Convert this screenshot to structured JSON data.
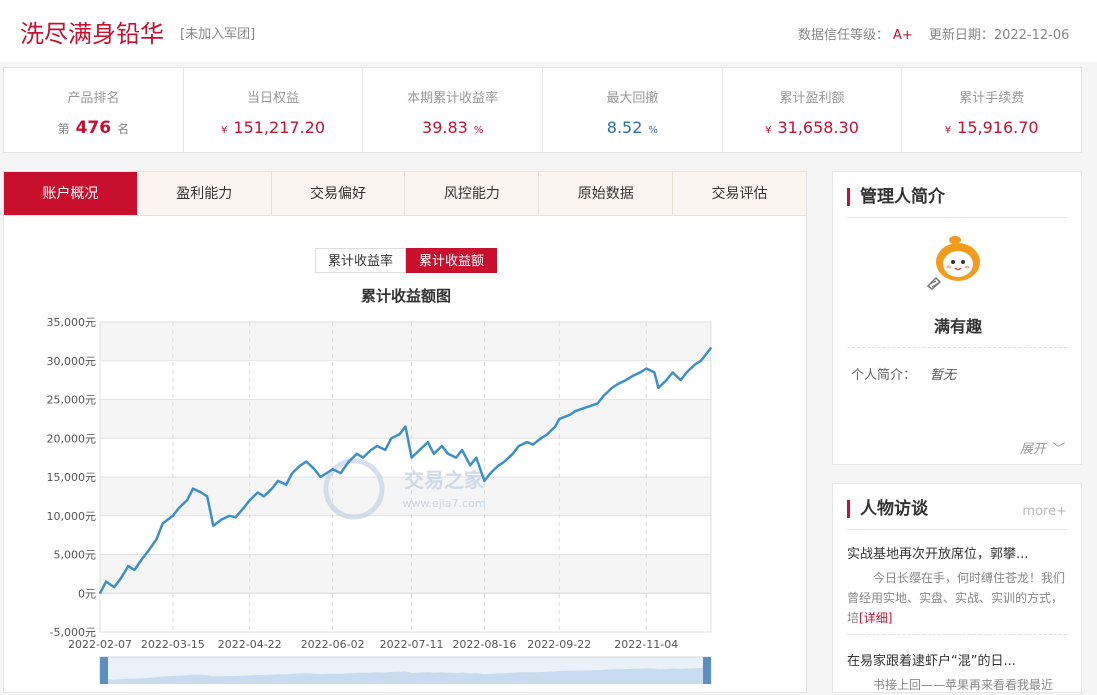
{
  "header": {
    "title": "洗尽满身铅华",
    "tag": "[未加入军团]",
    "trust_label": "数据信任等级：",
    "trust_grade": "A+",
    "update_label": "更新日期：",
    "update_date": "2022-12-06"
  },
  "stats": {
    "rank": {
      "label": "产品排名",
      "prefix": "第",
      "value": "476",
      "suffix": "名"
    },
    "equity": {
      "label": "当日权益",
      "currency": "¥",
      "value": "151,217.20"
    },
    "return_rate": {
      "label": "本期累计收益率",
      "value": "39.83",
      "unit": "%"
    },
    "max_drawdown": {
      "label": "最大回撤",
      "value": "8.52",
      "unit": "%"
    },
    "total_profit": {
      "label": "累计盈利额",
      "currency": "¥",
      "value": "31,658.30"
    },
    "total_fee": {
      "label": "累计手续费",
      "currency": "¥",
      "value": "15,916.70"
    }
  },
  "tabs": [
    "账户概况",
    "盈利能力",
    "交易偏好",
    "风控能力",
    "原始数据",
    "交易评估"
  ],
  "chart_toggle": [
    "累计收益率",
    "累计收益额"
  ],
  "colors": {
    "accent": "#c8102e",
    "line": "#3d8fc7",
    "blue_value": "#2a6fb0"
  },
  "watermark": {
    "text": "交易之家",
    "url": "www.ejia7.com"
  },
  "chart_data": {
    "type": "line",
    "title": "累计收益额图",
    "ylim": [
      -5000,
      35000
    ],
    "y_ticks": [
      "35,000元",
      "30,000元",
      "25,000元",
      "20,000元",
      "15,000元",
      "10,000元",
      "5,000元",
      "0元",
      "-5,000元"
    ],
    "x_ticks": [
      "2022-02-07",
      "2022-03-15",
      "2022-04-22",
      "2022-06-02",
      "2022-07-11",
      "2022-08-16",
      "2022-09-22",
      "2022-11-04"
    ],
    "x_range": [
      "2022-02-07",
      "2022-12-06"
    ],
    "grid": true,
    "series": [
      {
        "values": [
          [
            "2022-02-07",
            0
          ],
          [
            "2022-02-10",
            1500
          ],
          [
            "2022-02-14",
            800
          ],
          [
            "2022-02-17",
            1800
          ],
          [
            "2022-02-21",
            3500
          ],
          [
            "2022-02-24",
            3000
          ],
          [
            "2022-02-28",
            4500
          ],
          [
            "2022-03-03",
            5500
          ],
          [
            "2022-03-07",
            7000
          ],
          [
            "2022-03-10",
            9000
          ],
          [
            "2022-03-15",
            10000
          ],
          [
            "2022-03-18",
            11000
          ],
          [
            "2022-03-22",
            12000
          ],
          [
            "2022-03-25",
            13500
          ],
          [
            "2022-03-29",
            13000
          ],
          [
            "2022-04-01",
            12500
          ],
          [
            "2022-04-04",
            8700
          ],
          [
            "2022-04-08",
            9500
          ],
          [
            "2022-04-12",
            10000
          ],
          [
            "2022-04-15",
            9800
          ],
          [
            "2022-04-19",
            11000
          ],
          [
            "2022-04-22",
            12000
          ],
          [
            "2022-04-26",
            13000
          ],
          [
            "2022-04-29",
            12500
          ],
          [
            "2022-05-03",
            13500
          ],
          [
            "2022-05-06",
            14500
          ],
          [
            "2022-05-10",
            14000
          ],
          [
            "2022-05-13",
            15500
          ],
          [
            "2022-05-17",
            16500
          ],
          [
            "2022-05-20",
            17000
          ],
          [
            "2022-05-24",
            16000
          ],
          [
            "2022-05-27",
            15000
          ],
          [
            "2022-06-02",
            16000
          ],
          [
            "2022-06-06",
            15500
          ],
          [
            "2022-06-10",
            17000
          ],
          [
            "2022-06-14",
            18000
          ],
          [
            "2022-06-17",
            17500
          ],
          [
            "2022-06-21",
            18500
          ],
          [
            "2022-06-24",
            19000
          ],
          [
            "2022-06-28",
            18500
          ],
          [
            "2022-07-01",
            20000
          ],
          [
            "2022-07-05",
            20500
          ],
          [
            "2022-07-08",
            21500
          ],
          [
            "2022-07-11",
            17500
          ],
          [
            "2022-07-15",
            18500
          ],
          [
            "2022-07-19",
            19500
          ],
          [
            "2022-07-22",
            18000
          ],
          [
            "2022-07-26",
            19000
          ],
          [
            "2022-07-29",
            18000
          ],
          [
            "2022-08-02",
            17500
          ],
          [
            "2022-08-05",
            18500
          ],
          [
            "2022-08-09",
            16500
          ],
          [
            "2022-08-12",
            17500
          ],
          [
            "2022-08-16",
            14500
          ],
          [
            "2022-08-19",
            15500
          ],
          [
            "2022-08-23",
            16500
          ],
          [
            "2022-08-26",
            17000
          ],
          [
            "2022-08-30",
            18000
          ],
          [
            "2022-09-02",
            19000
          ],
          [
            "2022-09-06",
            19500
          ],
          [
            "2022-09-09",
            19200
          ],
          [
            "2022-09-13",
            20000
          ],
          [
            "2022-09-16",
            20500
          ],
          [
            "2022-09-20",
            21500
          ],
          [
            "2022-09-22",
            22500
          ],
          [
            "2022-09-27",
            23000
          ],
          [
            "2022-09-30",
            23500
          ],
          [
            "2022-10-11",
            24500
          ],
          [
            "2022-10-14",
            25500
          ],
          [
            "2022-10-18",
            26500
          ],
          [
            "2022-10-21",
            27000
          ],
          [
            "2022-10-25",
            27500
          ],
          [
            "2022-10-28",
            28000
          ],
          [
            "2022-11-01",
            28500
          ],
          [
            "2022-11-04",
            29000
          ],
          [
            "2022-11-08",
            28500
          ],
          [
            "2022-11-10",
            26500
          ],
          [
            "2022-11-14",
            27500
          ],
          [
            "2022-11-17",
            28500
          ],
          [
            "2022-11-21",
            27500
          ],
          [
            "2022-11-24",
            28500
          ],
          [
            "2022-11-28",
            29500
          ],
          [
            "2022-12-01",
            30000
          ],
          [
            "2022-12-06",
            31658
          ]
        ]
      }
    ]
  },
  "manager": {
    "section_title": "管理人简介",
    "name": "满有趣",
    "intro_label": "个人简介：",
    "intro_value": "暂无",
    "expand_label": "展开 ﹀"
  },
  "interviews": {
    "section_title": "人物访谈",
    "more_label": "more+",
    "items": [
      {
        "headline": "实战基地再次开放席位，郭攀...",
        "body": "今日长缨在手，何时缚住苍龙！我们曾经用实地、实盘、实战、实训的方式，培",
        "detail": "[详细]"
      },
      {
        "headline": "在易家跟着逮虾户“混”的日...",
        "body": "书接上回——苹果再来看看我最近",
        "detail": ""
      }
    ]
  }
}
